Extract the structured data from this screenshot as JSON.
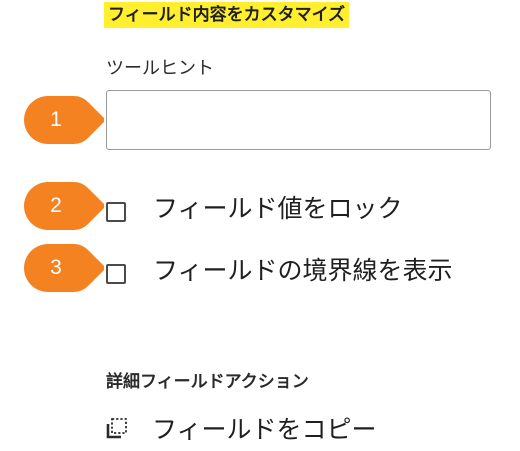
{
  "section": {
    "title": "フィールド内容をカスタマイズ"
  },
  "tooltip": {
    "label": "ツールヒント",
    "value": "",
    "placeholder": ""
  },
  "options": {
    "lock_label": "フィールド値をロック",
    "border_label": "フィールドの境界線を表示"
  },
  "advanced": {
    "heading": "詳細フィールドアクション",
    "copy_label": "フィールドをコピー",
    "copy_icon": "copy-icon"
  },
  "callouts": [
    "1",
    "2",
    "3"
  ],
  "colors": {
    "callout": "#f58220",
    "highlight": "#ffef2e"
  }
}
